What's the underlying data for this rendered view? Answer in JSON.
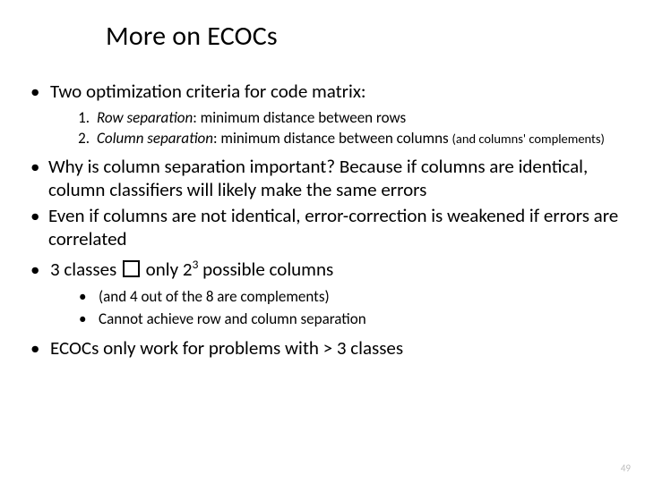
{
  "title": "More on ECOCs",
  "bullets": {
    "b1": "Two optimization criteria for code matrix:",
    "num1_term": "Row separation",
    "num1_rest": ": minimum distance between rows",
    "num2_term": "Column separation",
    "num2_rest": ": minimum distance between columns ",
    "num2_paren": "(and columns' complements)",
    "b2a": "Why is column separation important? Because if columns are identical, column classifiers will likely make the same errors",
    "b2b": "Even if columns are not identical, error-correction is weakened if errors are correlated",
    "b3_pre": "3 classes ",
    "b3_mid": " only 2",
    "b3_sup": "3",
    "b3_post": " possible columns",
    "sub1": "(and 4 out of the 8 are complements)",
    "sub2": "Cannot achieve row and column separation",
    "b4": "ECOCs only work for problems with > 3 classes"
  },
  "numbers": {
    "n1": "1.",
    "n2": "2."
  },
  "pagenum": "49"
}
